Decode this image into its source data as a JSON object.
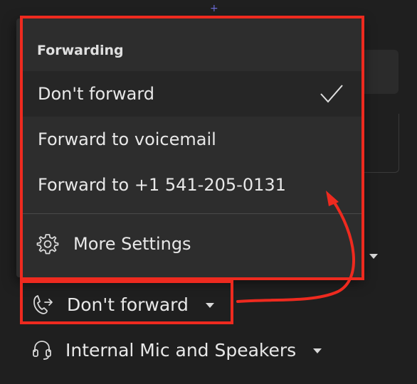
{
  "menu": {
    "header": "Forwarding",
    "items": [
      {
        "label": "Don't forward",
        "selected": true
      },
      {
        "label": "Forward to voicemail",
        "selected": false
      },
      {
        "label": "Forward to +1 541-205-0131",
        "selected": false
      }
    ],
    "more_settings_label": "More Settings"
  },
  "controls": {
    "forward_label": "Don't forward",
    "audio_label": "Internal Mic and Speakers"
  },
  "icons": {
    "check": "checkmark-icon",
    "settings": "gear-icon",
    "forward": "call-forward-icon",
    "audio": "headset-icon",
    "caret": "chevron-down-icon"
  },
  "colors": {
    "annotation": "#ee2a1f",
    "menu_bg": "#2d2d2d",
    "selected_bg": "#262626",
    "page_bg": "#1f1f1f",
    "text": "#e8e8e8"
  }
}
